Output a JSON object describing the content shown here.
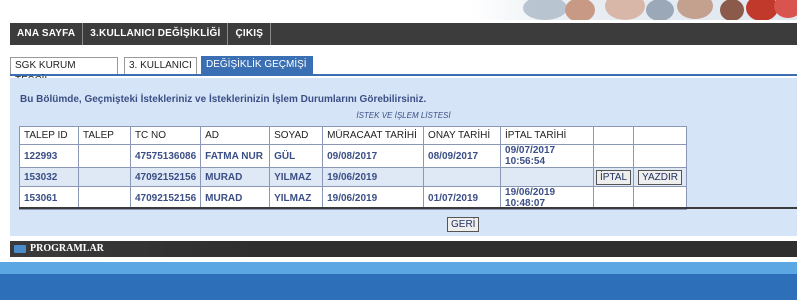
{
  "nav": {
    "items": [
      {
        "label": "ANA SAYFA"
      },
      {
        "label": "3.KULLANICI DEĞİŞİKLİĞİ"
      },
      {
        "label": "ÇIKIŞ"
      }
    ]
  },
  "tabs": [
    {
      "label": "SGK KURUM TESCİL",
      "active": false
    },
    {
      "label": "3. KULLANICI",
      "active": false
    },
    {
      "label": "DEĞİŞİKLİK GEÇMİŞİ",
      "active": true
    }
  ],
  "main": {
    "intro": "Bu Bölümde, Geçmişteki İstekleriniz ve İsteklerinizin İşlem Durumlarını Görebilirsiniz.",
    "list_title": "İSTEK VE İŞLEM LİSTESİ",
    "columns": [
      "TALEP ID",
      "TALEP",
      "TC NO",
      "AD",
      "SOYAD",
      "MÜRACAAT TARİHİ",
      "ONAY TARİHİ",
      "İPTAL TARİHİ",
      "",
      ""
    ],
    "rows": [
      {
        "talep_id": "122993",
        "talep": "",
        "tc_no": "47575136086",
        "ad": "FATMA NUR",
        "soyad": "GÜL",
        "muracaat": "09/08/2017",
        "onay": "08/09/2017",
        "iptal": "09/07/2017 10:56:54",
        "btn1": "",
        "btn2": ""
      },
      {
        "talep_id": "153032",
        "talep": "",
        "tc_no": "47092152156",
        "ad": "MURAD",
        "soyad": "YILMAZ",
        "muracaat": "19/06/2019",
        "onay": "",
        "iptal": "",
        "btn1": "İPTAL",
        "btn2": "YAZDIR"
      },
      {
        "talep_id": "153061",
        "talep": "",
        "tc_no": "47092152156",
        "ad": "MURAD",
        "soyad": "YILMAZ",
        "muracaat": "19/06/2019",
        "onay": "01/07/2019",
        "iptal": "19/06/2019 10:48:07",
        "btn1": "",
        "btn2": ""
      }
    ],
    "back_label": "GERİ"
  },
  "footer": {
    "programs_label": "PROGRAMLAR"
  },
  "colors": {
    "nav_bg": "#3c3c3c",
    "tab_active": "#3b6fb3",
    "panel_bg": "#d5e4f6",
    "text_blue": "#3b4f86"
  }
}
